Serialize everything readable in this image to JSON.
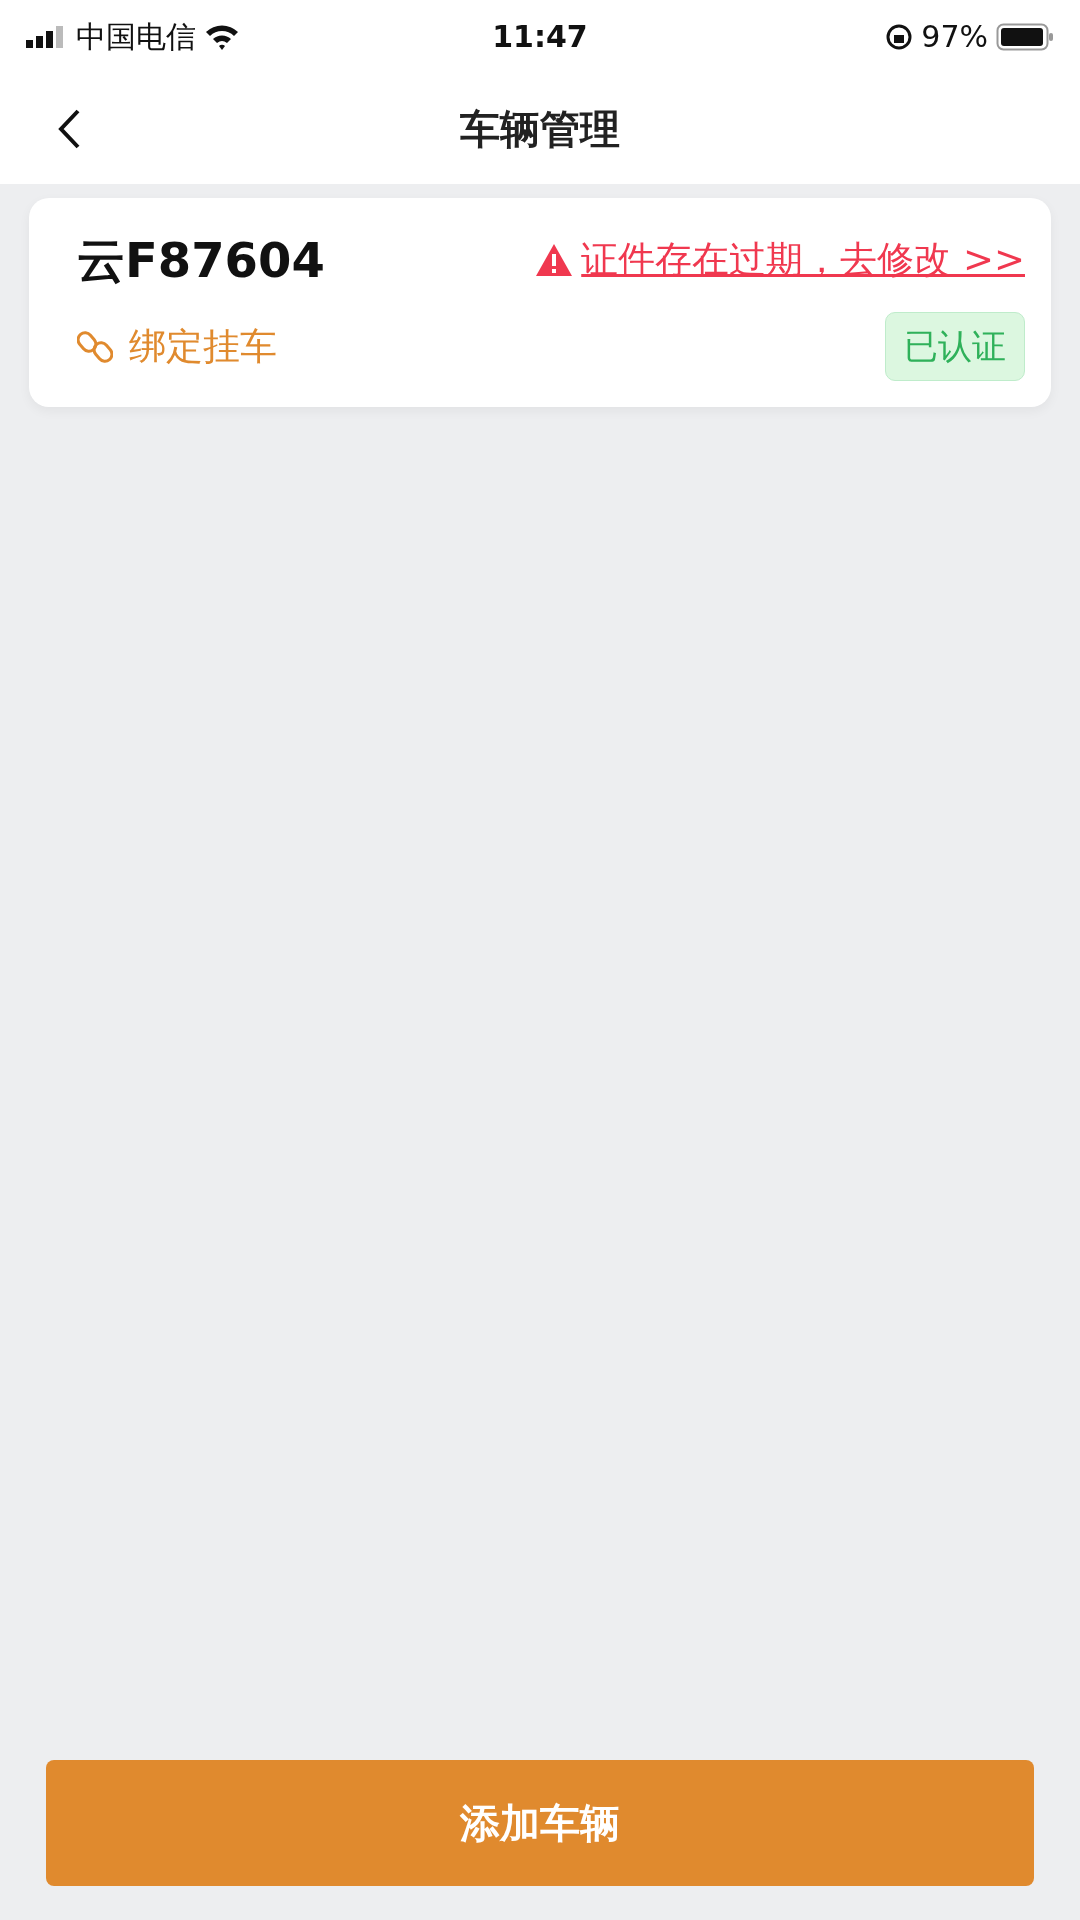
{
  "status_bar": {
    "carrier": "中国电信",
    "time": "11:47",
    "battery": "97%"
  },
  "nav": {
    "title": "车辆管理"
  },
  "vehicles": [
    {
      "plate": "云F87604",
      "warning": "证件存在过期，去修改 >>",
      "bind_link": "绑定挂车",
      "status": "已认证"
    }
  ],
  "add_button": "添加车辆"
}
